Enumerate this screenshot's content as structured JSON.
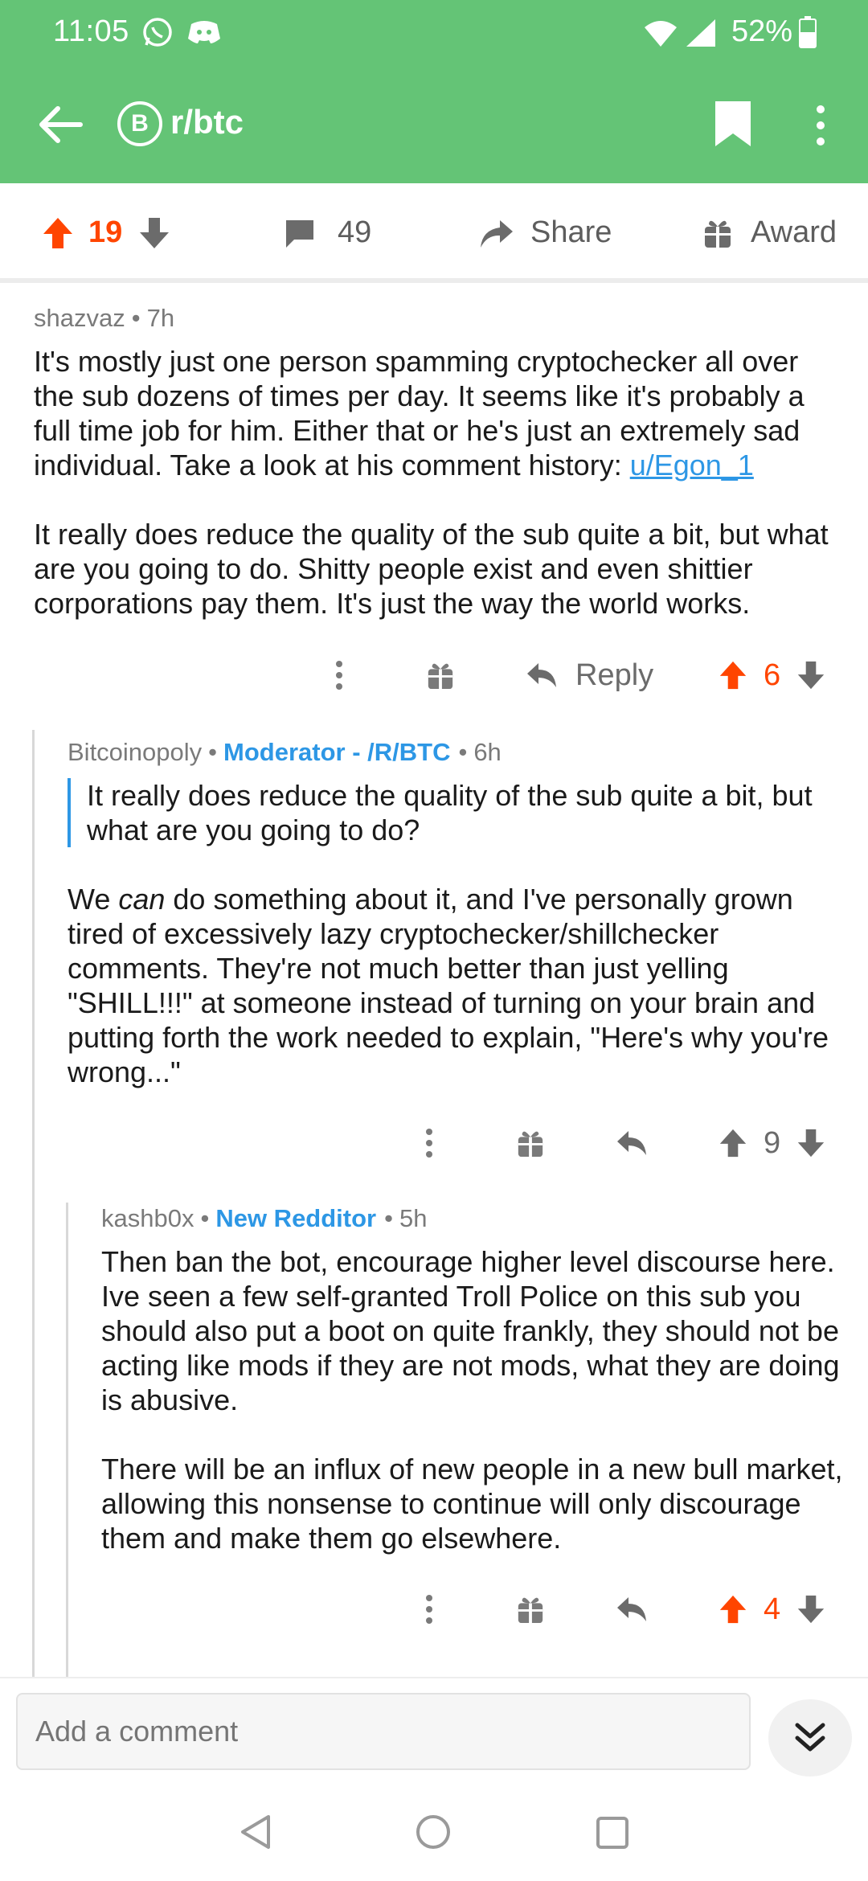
{
  "status_bar": {
    "time": "11:05",
    "battery": "52%"
  },
  "app_bar": {
    "subreddit": "r/btc",
    "badge_symbol": "B"
  },
  "post_actions": {
    "score": "19",
    "comments": "49",
    "share": "Share",
    "award": "Award"
  },
  "comments": [
    {
      "author": "shazvaz",
      "age": "7h",
      "paragraphs": [
        "It's mostly just one person spamming cryptochecker all over the sub dozens of times per day. It seems like it's probably a full time job for him. Either that or he's just an extremely sad individual.  Take a look at his comment history: ",
        "It really does reduce the quality of the sub quite a bit, but what are you going to do. Shitty people exist and even shittier corporations pay them. It's just the way the world works."
      ],
      "link": "u/Egon_1",
      "reply_label": "Reply",
      "score": "6"
    },
    {
      "author": "Bitcoinopoly",
      "flair": "Moderator - /R/BTC",
      "age": "6h",
      "quote": "It really does reduce the quality of the sub quite a bit, but what are you going to do?",
      "body_pre": "We ",
      "body_em": "can",
      "body_post": " do something about it, and I've personally grown tired of excessively lazy cryptochecker/shillchecker comments. They're not much better than just yelling \"SHILL!!!\" at someone instead of turning on your brain and putting forth the work needed to explain, \"Here's why you're wrong...\"",
      "score": "9"
    },
    {
      "author": "kashb0x",
      "flair": "New Redditor",
      "age": "5h",
      "paragraphs": [
        "Then ban the bot, encourage higher level discourse here. Ive seen a few self-granted Troll Police on this sub you should also put a boot on quite frankly, they should not be acting like mods if they are not mods, what they are doing is abusive.",
        "There will be an influx of new people in a new bull market, allowing this nonsense to continue will only discourage them and make them go elsewhere."
      ],
      "score": "4"
    }
  ],
  "comment_box": {
    "placeholder": "Add a comment"
  },
  "colors": {
    "header": "#64c476",
    "upvote": "#ff4500",
    "flair": "#2d97e5"
  }
}
